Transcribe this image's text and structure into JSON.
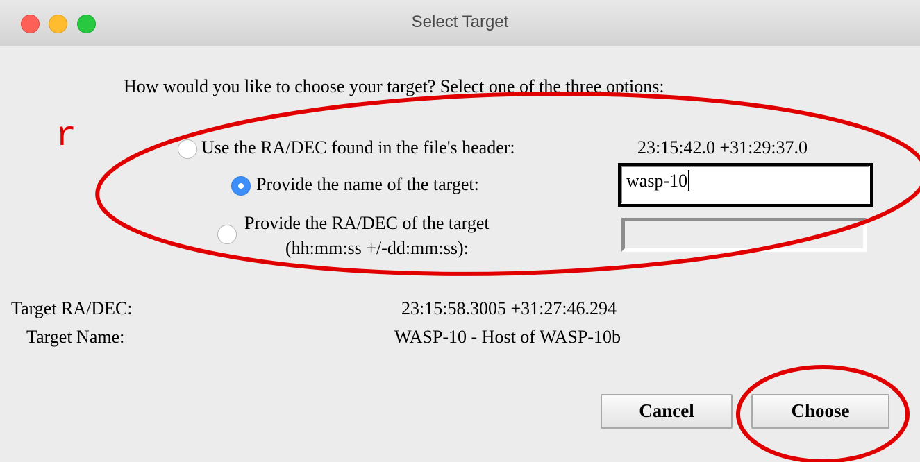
{
  "window": {
    "title": "Select Target"
  },
  "prompt": "How would you like to choose your target? Select one of the three options:",
  "options": [
    {
      "label": "Use the RA/DEC found in the file's header:",
      "value": "23:15:42.0 +31:29:37.0",
      "selected": false
    },
    {
      "label": "Provide the name of the target:",
      "input_value": "wasp-10",
      "selected": true
    },
    {
      "label_line1": "Provide the RA/DEC of the target",
      "label_line2": "(hh:mm:ss +/-dd:mm:ss):",
      "input_value": "",
      "selected": false
    }
  ],
  "target": {
    "radec_label": "Target RA/DEC:",
    "radec_value": "23:15:58.3005 +31:27:46.294",
    "name_label": "Target Name:",
    "name_value": "WASP-10 - Host of WASP-10b"
  },
  "buttons": {
    "cancel": "Cancel",
    "choose": "Choose"
  },
  "annotation": {
    "letter": "r",
    "color": "#e00000"
  },
  "colors": {
    "radio_selected": "#3d8ef8",
    "background": "#ececec"
  }
}
